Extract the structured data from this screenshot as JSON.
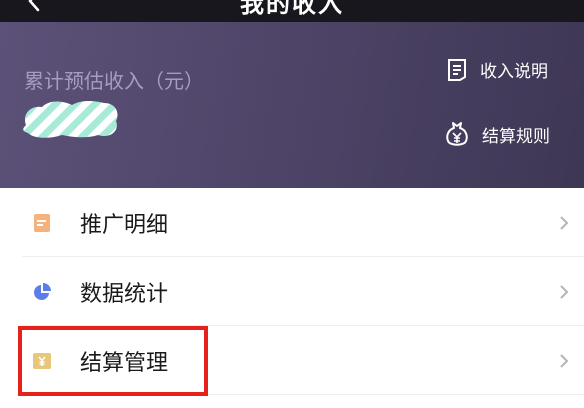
{
  "header": {
    "title": "我的收入"
  },
  "banner": {
    "income_label": "累计预估收入（元）",
    "links": [
      {
        "label": "收入说明",
        "icon": "document-icon"
      },
      {
        "label": "结算规则",
        "icon": "yuan-bag-icon"
      }
    ]
  },
  "menu": {
    "items": [
      {
        "label": "推广明细",
        "icon": "list-doc-icon",
        "icon_color": "#f39b5b"
      },
      {
        "label": "数据统计",
        "icon": "pie-chart-icon",
        "icon_color": "#5b7de8"
      },
      {
        "label": "结算管理",
        "icon": "yuan-card-icon",
        "icon_color": "#e3c06d"
      }
    ]
  },
  "colors": {
    "banner_bg": "#4f4569",
    "highlight": "#e5211b"
  }
}
